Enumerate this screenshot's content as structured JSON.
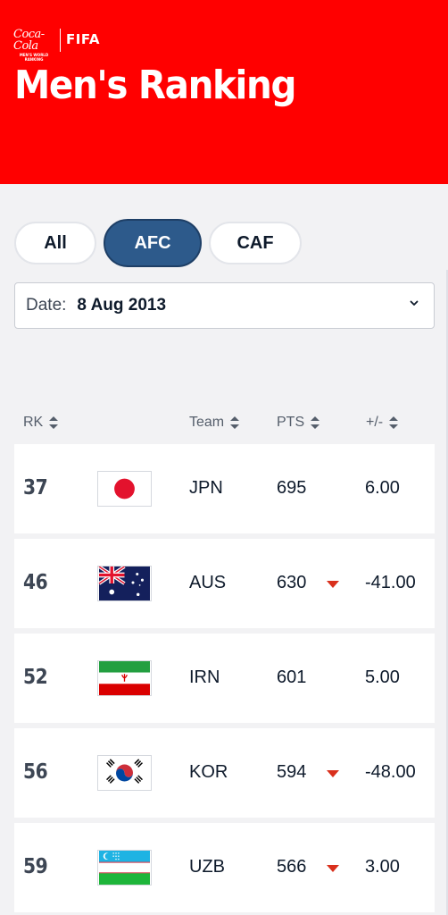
{
  "header": {
    "logo_brand": "Coca-Cola",
    "logo_sub": "MEN'S WORLD RANKING",
    "logo_fifa": "FIFA",
    "title": "Men's Ranking",
    "bg_color": "#ff0000"
  },
  "filters": {
    "items": [
      {
        "label": "All",
        "active": false
      },
      {
        "label": "AFC",
        "active": true
      },
      {
        "label": "CAF",
        "active": false
      }
    ],
    "active_color": "#2d5a8b"
  },
  "date_select": {
    "label": "Date:",
    "value": "8 Aug 2013",
    "icon": "chevron-down-icon"
  },
  "table": {
    "columns": {
      "rank": "RK",
      "team": "Team",
      "points": "PTS",
      "change": "+/-"
    },
    "rows": [
      {
        "rank": "37",
        "flag": "japan-flag-icon",
        "team": "JPN",
        "points": "695",
        "trend": "none",
        "change": "6.00"
      },
      {
        "rank": "46",
        "flag": "australia-flag-icon",
        "team": "AUS",
        "points": "630",
        "trend": "down",
        "change": "-41.00"
      },
      {
        "rank": "52",
        "flag": "iran-flag-icon",
        "team": "IRN",
        "points": "601",
        "trend": "none",
        "change": "5.00"
      },
      {
        "rank": "56",
        "flag": "south-korea-flag-icon",
        "team": "KOR",
        "points": "594",
        "trend": "down",
        "change": "-48.00"
      },
      {
        "rank": "59",
        "flag": "uzbekistan-flag-icon",
        "team": "UZB",
        "points": "566",
        "trend": "down",
        "change": "3.00"
      }
    ],
    "trend_down_color": "#d9301c"
  }
}
